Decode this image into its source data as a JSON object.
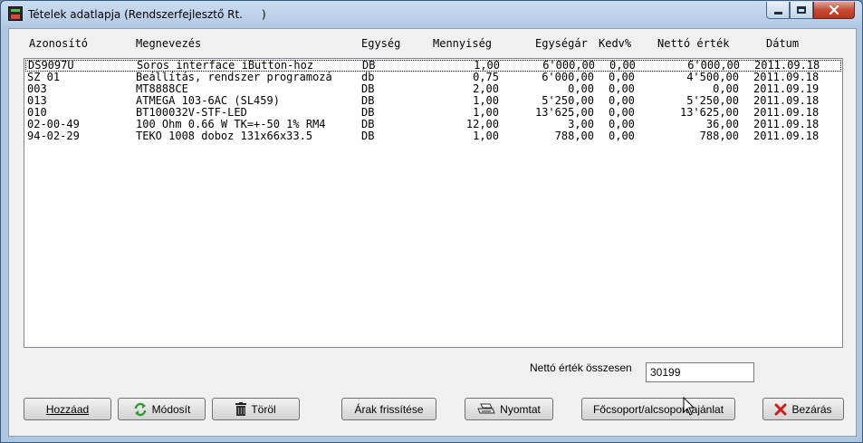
{
  "window": {
    "title": "Tételek adatlapja (Rendszerfejlesztő Rt.",
    "title_paren": ")",
    "controls": {
      "minimize": "minimize",
      "maximize": "maximize",
      "close": "close"
    }
  },
  "columns": [
    "Azonosító",
    "Megnevezés",
    "Egység",
    "Mennyiség",
    "Egységár",
    "Kedv%",
    "Nettó érték",
    "Dátum"
  ],
  "rows": [
    {
      "id": "DS9097U",
      "name": "Soros interface iButton-hoz",
      "unit": "DB",
      "qty": "1,00",
      "price": "6'000,00",
      "disc": "0,00",
      "net": "6'000,00",
      "date": "2011.09.18"
    },
    {
      "id": "SZ 01",
      "name": "Beállítás, rendszer programozá",
      "unit": "db",
      "qty": "0,75",
      "price": "6'000,00",
      "disc": "0,00",
      "net": "4'500,00",
      "date": "2011.09.18"
    },
    {
      "id": "003",
      "name": "MT8888CE",
      "unit": "DB",
      "qty": "2,00",
      "price": "0,00",
      "disc": "0,00",
      "net": "0,00",
      "date": "2011.09.19"
    },
    {
      "id": "013",
      "name": "ATMEGA 103-6AC (SL459)",
      "unit": "DB",
      "qty": "1,00",
      "price": "5'250,00",
      "disc": "0,00",
      "net": "5'250,00",
      "date": "2011.09.18"
    },
    {
      "id": "010",
      "name": "BT100032V-STF-LED",
      "unit": "DB",
      "qty": "1,00",
      "price": "13'625,00",
      "disc": "0,00",
      "net": "13'625,00",
      "date": "2011.09.18"
    },
    {
      "id": "02-00-49",
      "name": "100 Ohm 0.66 W TK=+-50 1% RM4",
      "unit": "DB",
      "qty": "12,00",
      "price": "3,00",
      "disc": "0,00",
      "net": "36,00",
      "date": "2011.09.18"
    },
    {
      "id": "94-02-29",
      "name": "TEKO 1008 doboz 131x66x33.5",
      "unit": "DB",
      "qty": "1,00",
      "price": "788,00",
      "disc": "0,00",
      "net": "788,00",
      "date": "2011.09.18"
    }
  ],
  "total": {
    "label": "Nettó érték összesen",
    "value": "30199"
  },
  "buttons": {
    "add": "Hozzáad",
    "edit": "Módosít",
    "delete": "Töröl",
    "refresh_prices": "Árak frissítése",
    "print": "Nyomtat",
    "group_offer": "Főcsoport/alcsoport ajánlat",
    "close": "Bezárás"
  },
  "icons": {
    "app": "app-icon",
    "edit": "refresh-arrows-icon",
    "delete": "trash-icon",
    "print": "printer-icon",
    "close": "red-x-icon"
  },
  "colors": {
    "titlebar": "#b7cde6",
    "close_button": "#c74a34",
    "dialog_bg": "#f0f0f0",
    "refresh_icon": "#2e9a2e",
    "close_x": "#d11a1a"
  }
}
